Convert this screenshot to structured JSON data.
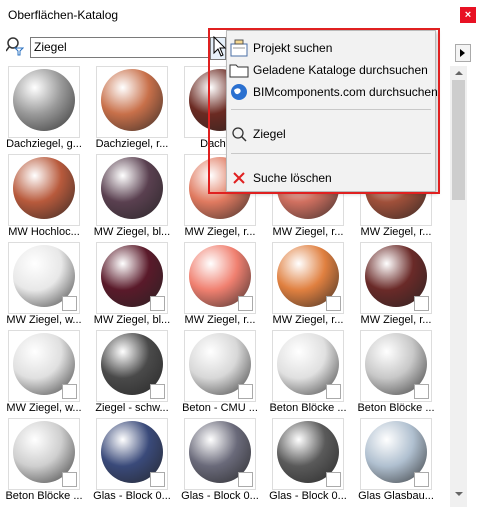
{
  "window": {
    "title": "Oberflächen-Katalog",
    "close_label": "×"
  },
  "search": {
    "value": "Ziegel"
  },
  "menu": {
    "items": [
      {
        "label": "Projekt suchen",
        "icon": "project-icon"
      },
      {
        "label": "Geladene Kataloge durchsuchen",
        "icon": "folder-icon"
      },
      {
        "label": "BIMcomponents.com durchsuchen",
        "icon": "globe-icon"
      },
      {
        "label": "Ziegel",
        "icon": "search-icon"
      },
      {
        "label": "Suche löschen",
        "icon": "delete-x-icon"
      }
    ],
    "highlight_color": "#e02020"
  },
  "tiles": [
    {
      "caption": "Dachziegel, g...",
      "color": "#9a9a9a"
    },
    {
      "caption": "Dachziegel, r...",
      "color": "#c8704a"
    },
    {
      "caption": "Dachzie",
      "color": "#6b2a22"
    },
    {
      "caption": "",
      "color": "#ffffff"
    },
    {
      "caption": "",
      "color": "#ffffff"
    },
    {
      "caption": "MW Hochloc...",
      "color": "#b85a3c"
    },
    {
      "caption": "MW Ziegel, bl...",
      "color": "#5a4050"
    },
    {
      "caption": "MW Ziegel, r...",
      "color": "#e07a60"
    },
    {
      "caption": "MW Ziegel, r...",
      "color": "#d07060"
    },
    {
      "caption": "MW Ziegel, r...",
      "color": "#a0503a"
    },
    {
      "caption": "MW Ziegel, w...",
      "color": "#e8e8e8"
    },
    {
      "caption": "MW Ziegel, bl...",
      "color": "#5a1a2a"
    },
    {
      "caption": "MW Ziegel, r...",
      "color": "#f08070"
    },
    {
      "caption": "MW Ziegel, r...",
      "color": "#e08040"
    },
    {
      "caption": "MW Ziegel, r...",
      "color": "#6a2a28"
    },
    {
      "caption": "MW Ziegel, w...",
      "color": "#e0e0e0"
    },
    {
      "caption": "Ziegel - schw...",
      "color": "#4a4a4a"
    },
    {
      "caption": "Beton - CMU ...",
      "color": "#d8d8d8"
    },
    {
      "caption": "Beton Blöcke ...",
      "color": "#e0e0e0"
    },
    {
      "caption": "Beton Blöcke ...",
      "color": "#c8c8c8"
    },
    {
      "caption": "Beton Blöcke ...",
      "color": "#cfcfcf"
    },
    {
      "caption": "Glas - Block 0...",
      "color": "#3a4a7a"
    },
    {
      "caption": "Glas - Block 0...",
      "color": "#6a6a7a"
    },
    {
      "caption": "Glas - Block 0...",
      "color": "#5a5a5a"
    },
    {
      "caption": "Glas Glasbau...",
      "color": "#b0c0d0"
    }
  ]
}
